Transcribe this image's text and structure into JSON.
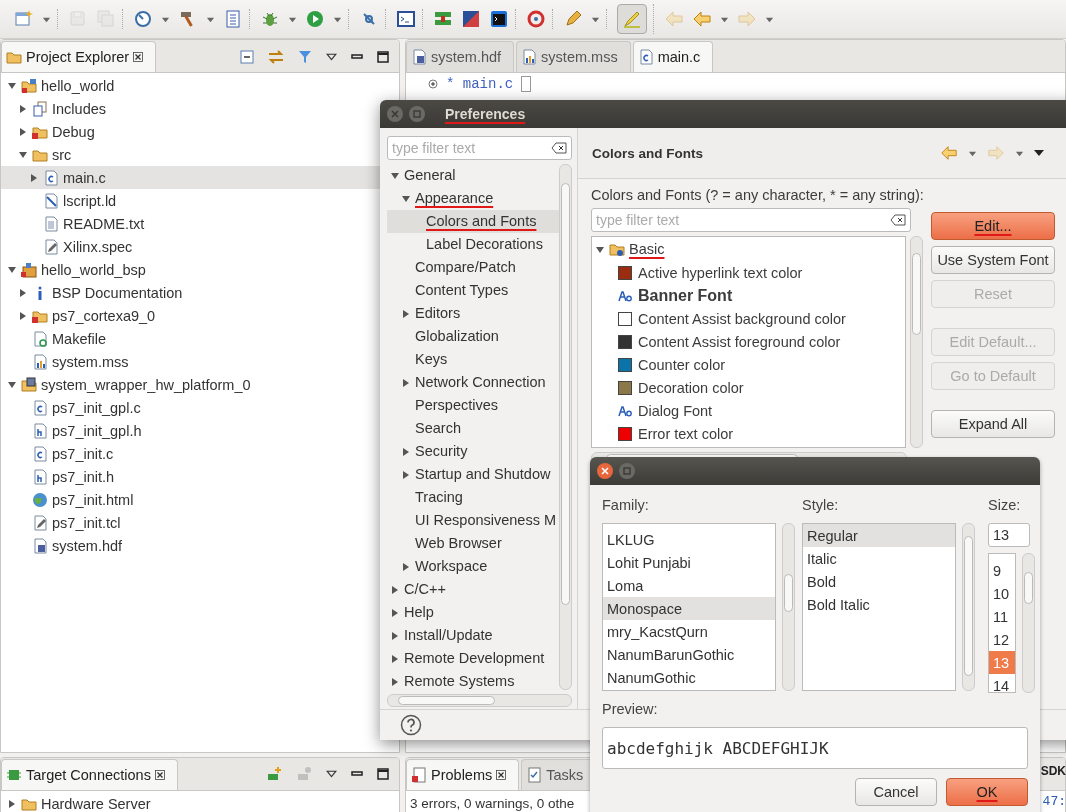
{
  "toolbar": [
    [
      {
        "kind": "new",
        "disabled": false,
        "pressed": false,
        "dropdown": true
      }
    ],
    [
      {
        "kind": "save",
        "disabled": true,
        "pressed": false,
        "dropdown": false
      },
      {
        "kind": "save_all",
        "disabled": true,
        "pressed": false,
        "dropdown": false
      }
    ],
    [
      {
        "kind": "gauge",
        "disabled": false,
        "pressed": false,
        "dropdown": true
      },
      {
        "kind": "hammer",
        "disabled": false,
        "pressed": false,
        "dropdown": true
      },
      {
        "kind": "binary",
        "disabled": false,
        "pressed": false,
        "dropdown": false
      }
    ],
    [
      {
        "kind": "bug",
        "disabled": false,
        "pressed": false,
        "dropdown": true
      },
      {
        "kind": "run",
        "disabled": false,
        "pressed": false,
        "dropdown": true
      }
    ],
    [
      {
        "kind": "pin",
        "disabled": false,
        "pressed": false,
        "dropdown": false
      }
    ],
    [
      {
        "kind": "terminal",
        "disabled": false,
        "pressed": false,
        "dropdown": false
      }
    ],
    [
      {
        "kind": "program",
        "disabled": false,
        "pressed": false,
        "dropdown": false
      },
      {
        "kind": "gradient",
        "disabled": false,
        "pressed": false,
        "dropdown": false
      },
      {
        "kind": "console",
        "disabled": false,
        "pressed": false,
        "dropdown": false
      }
    ],
    [
      {
        "kind": "refresh",
        "disabled": false,
        "pressed": false,
        "dropdown": false
      }
    ],
    [
      {
        "kind": "pen",
        "disabled": false,
        "pressed": false,
        "dropdown": true
      }
    ],
    [
      {
        "kind": "highlighter",
        "disabled": false,
        "pressed": true,
        "dropdown": false
      }
    ],
    [
      {
        "kind": "back",
        "disabled": true,
        "pressed": false,
        "dropdown": false
      },
      {
        "kind": "back",
        "disabled": false,
        "pressed": false,
        "dropdown": true
      },
      {
        "kind": "forward",
        "disabled": true,
        "pressed": false,
        "dropdown": true
      }
    ]
  ],
  "project_explorer": {
    "title": "Project Explorer",
    "tree": [
      {
        "label": "hello_world",
        "kind": "project",
        "expanded": true,
        "selected": false,
        "children": [
          {
            "label": "Includes",
            "kind": "includes",
            "expanded": false,
            "selected": false
          },
          {
            "label": "Debug",
            "kind": "folder_error",
            "expanded": false,
            "selected": false
          },
          {
            "label": "src",
            "kind": "folder",
            "expanded": true,
            "selected": false,
            "children": [
              {
                "label": "main.c",
                "kind": "c",
                "expanded": false,
                "selected": true
              },
              {
                "label": "lscript.ld",
                "kind": "linker",
                "selected": false
              },
              {
                "label": "README.txt",
                "kind": "text",
                "selected": false
              },
              {
                "label": "Xilinx.spec",
                "kind": "edit",
                "selected": false
              }
            ]
          }
        ]
      },
      {
        "label": "hello_world_bsp",
        "kind": "bsp",
        "expanded": true,
        "selected": false,
        "children": [
          {
            "label": "BSP Documentation",
            "kind": "info",
            "expanded": false,
            "selected": false
          },
          {
            "label": "ps7_cortexa9_0",
            "kind": "folder_error",
            "expanded": false,
            "selected": false
          },
          {
            "label": "Makefile",
            "kind": "makefile",
            "selected": false
          },
          {
            "label": "system.mss",
            "kind": "mss",
            "selected": false
          }
        ]
      },
      {
        "label": "system_wrapper_hw_platform_0",
        "kind": "hw",
        "expanded": true,
        "selected": false,
        "children": [
          {
            "label": "ps7_init_gpl.c",
            "kind": "c",
            "selected": false
          },
          {
            "label": "ps7_init_gpl.h",
            "kind": "h",
            "selected": false
          },
          {
            "label": "ps7_init.c",
            "kind": "c",
            "selected": false
          },
          {
            "label": "ps7_init.h",
            "kind": "h",
            "selected": false
          },
          {
            "label": "ps7_init.html",
            "kind": "html",
            "selected": false
          },
          {
            "label": "ps7_init.tcl",
            "kind": "edit",
            "selected": false
          },
          {
            "label": "system.hdf",
            "kind": "hdf",
            "selected": false
          }
        ]
      }
    ]
  },
  "target_connections": {
    "title": "Target Connections",
    "tree": [
      {
        "label": "Hardware Server",
        "kind": "folder",
        "expanded": false,
        "selected": false
      }
    ]
  },
  "editor": {
    "tabs": [
      {
        "label": "system.hdf",
        "kind": "hdf",
        "selected": false
      },
      {
        "label": "system.mss",
        "kind": "mss",
        "selected": false
      },
      {
        "label": "main.c",
        "kind": "c",
        "selected": true
      }
    ],
    "line": "* main.c"
  },
  "problems": {
    "tabs": [
      {
        "label": "Problems",
        "selected": true
      },
      {
        "label": "Tasks",
        "selected": false
      }
    ],
    "summary": "3 errors, 0 warnings, 0 othe",
    "side_tab": "SDK",
    "position": "47:"
  },
  "preferences": {
    "title": {
      "text": "Preferences",
      "annotated": true
    },
    "filter_placeholder": "type filter text",
    "tree": [
      {
        "label": "General",
        "expanded": true,
        "selected": false,
        "annotated": false,
        "children": [
          {
            "label": "Appearance",
            "expanded": true,
            "selected": false,
            "annotated": true,
            "children": [
              {
                "label": "Colors and Fonts",
                "selected": true,
                "annotated": true
              },
              {
                "label": "Label Decorations",
                "selected": false,
                "annotated": false
              }
            ]
          },
          {
            "label": "Compare/Patch",
            "selected": false,
            "annotated": false
          },
          {
            "label": "Content Types",
            "selected": false,
            "annotated": false
          },
          {
            "label": "Editors",
            "expanded": false,
            "selected": false,
            "annotated": false
          },
          {
            "label": "Globalization",
            "selected": false,
            "annotated": false
          },
          {
            "label": "Keys",
            "selected": false,
            "annotated": false
          },
          {
            "label": "Network Connection",
            "expanded": false,
            "selected": false,
            "annotated": false
          },
          {
            "label": "Perspectives",
            "selected": false,
            "annotated": false
          },
          {
            "label": "Search",
            "selected": false,
            "annotated": false
          },
          {
            "label": "Security",
            "expanded": false,
            "selected": false,
            "annotated": false
          },
          {
            "label": "Startup and Shutdow",
            "expanded": false,
            "selected": false,
            "annotated": false
          },
          {
            "label": "Tracing",
            "selected": false,
            "annotated": false
          },
          {
            "label": "UI Responsiveness M",
            "selected": false,
            "annotated": false
          },
          {
            "label": "Web Browser",
            "selected": false,
            "annotated": false
          },
          {
            "label": "Workspace",
            "expanded": false,
            "selected": false,
            "annotated": false
          }
        ]
      },
      {
        "label": "C/C++",
        "expanded": false,
        "selected": false,
        "annotated": false
      },
      {
        "label": "Help",
        "expanded": false,
        "selected": false,
        "annotated": false
      },
      {
        "label": "Install/Update",
        "expanded": false,
        "selected": false,
        "annotated": false
      },
      {
        "label": "Remote Development",
        "expanded": false,
        "selected": false,
        "annotated": false
      },
      {
        "label": "Remote Systems",
        "expanded": false,
        "selected": false,
        "annotated": false
      }
    ],
    "page": {
      "title": "Colors and Fonts",
      "description": "Colors and Fonts (? = any character, * = any string):",
      "filter_placeholder": "type filter text",
      "category": {
        "label": "Basic",
        "expanded": true,
        "annotated": true
      },
      "entries": [
        {
          "label": "Active hyperlink text color",
          "kind": "color",
          "color": "#9a2d10",
          "bold": false
        },
        {
          "label": "Banner Font",
          "kind": "font",
          "bold": true
        },
        {
          "label": "Content Assist background color",
          "kind": "color",
          "color": "#ffffff",
          "bold": false
        },
        {
          "label": "Content Assist foreground color",
          "kind": "color",
          "color": "#333333",
          "bold": false
        },
        {
          "label": "Counter color",
          "kind": "color",
          "color": "#0a74a8",
          "bold": false
        },
        {
          "label": "Decoration color",
          "kind": "color",
          "color": "#8c7748",
          "bold": false
        },
        {
          "label": "Dialog Font",
          "kind": "font",
          "bold": false
        },
        {
          "label": "Error text color",
          "kind": "color",
          "color": "#ee0000",
          "bold": false
        }
      ],
      "buttons": [
        {
          "label": "Edit...",
          "disabled": false,
          "default": true,
          "annotated": true
        },
        {
          "label": "Use System Font",
          "disabled": false,
          "default": false,
          "annotated": false
        },
        {
          "label": "Reset",
          "disabled": true,
          "default": false,
          "annotated": false
        },
        {
          "label": "Edit Default...",
          "disabled": true,
          "default": false,
          "annotated": false
        },
        {
          "label": "Go to Default",
          "disabled": true,
          "default": false,
          "annotated": false
        },
        {
          "label": "Expand All",
          "disabled": false,
          "default": false,
          "annotated": false
        }
      ]
    }
  },
  "font_dialog": {
    "family_label": "Family:",
    "families": [
      {
        "label": "LKLUG",
        "selected": false
      },
      {
        "label": "Lohit Punjabi",
        "selected": false
      },
      {
        "label": "Loma",
        "selected": false
      },
      {
        "label": "Monospace",
        "selected": true
      },
      {
        "label": "mry_KacstQurn",
        "selected": false
      },
      {
        "label": "NanumBarunGothic",
        "selected": false
      },
      {
        "label": "NanumGothic",
        "selected": false
      }
    ],
    "style_label": "Style:",
    "styles": [
      {
        "label": "Regular",
        "selected": true
      },
      {
        "label": "Italic",
        "selected": false
      },
      {
        "label": "Bold",
        "selected": false
      },
      {
        "label": "Bold Italic",
        "selected": false
      }
    ],
    "size_label": "Size:",
    "size_value": "13",
    "sizes": [
      {
        "label": "9",
        "selected": false
      },
      {
        "label": "10",
        "selected": false
      },
      {
        "label": "11",
        "selected": false
      },
      {
        "label": "12",
        "selected": false
      },
      {
        "label": "13",
        "selected": true
      },
      {
        "label": "14",
        "selected": false
      }
    ],
    "preview_label": "Preview:",
    "preview_text": "abcdefghijk ABCDEFGHIJK",
    "buttons": [
      {
        "label": "Cancel",
        "default": false,
        "annotated": false
      },
      {
        "label": "OK",
        "default": true,
        "annotated": true
      }
    ]
  }
}
